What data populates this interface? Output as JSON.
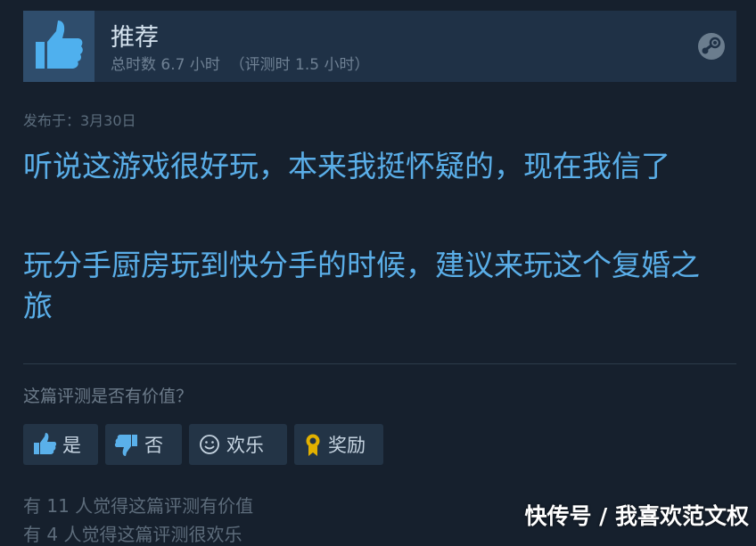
{
  "review_header": {
    "recommendation": "推荐",
    "hours_text": "总时数 6.7 小时  （评测时 1.5 小时）"
  },
  "posted": "发布于：3月30日",
  "review_body": [
    "听说这游戏很好玩，本来我挺怀疑的，现在我信了",
    "玩分手厨房玩到快分手的时候，建议来玩这个复婚之旅"
  ],
  "helpful": {
    "question": "这篇评测是否有价值？",
    "buttons": [
      {
        "label": "是",
        "icon": "thumbs-up-icon"
      },
      {
        "label": "否",
        "icon": "thumbs-down-icon"
      },
      {
        "label": "欢乐",
        "icon": "smiley-icon"
      },
      {
        "label": "奖励",
        "icon": "award-icon"
      }
    ]
  },
  "stats": [
    "有 11 人觉得这篇评测有价值",
    "有 4 人觉得这篇评测很欢乐"
  ],
  "watermark": "快传号 / 我喜欢范文权",
  "colors": {
    "background": "#16202d",
    "header": "#1f3146",
    "review_text": "#5aaee8",
    "award": "#e2b100"
  }
}
